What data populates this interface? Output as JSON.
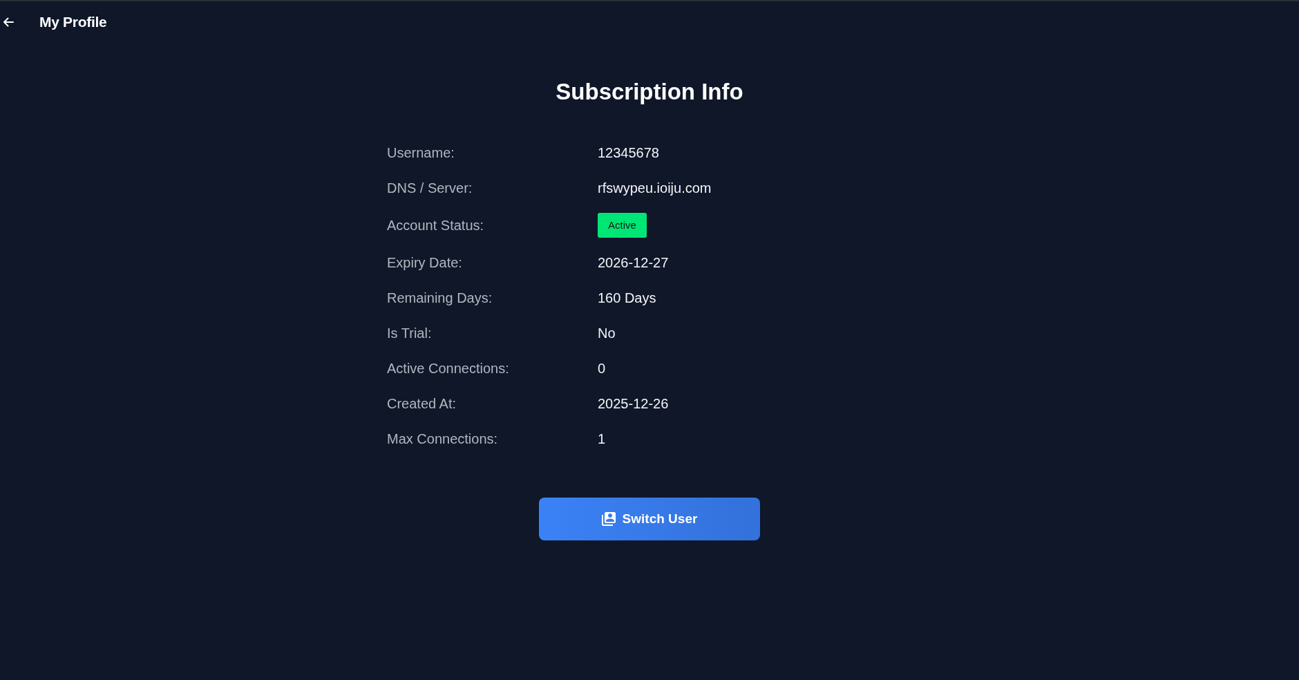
{
  "header": {
    "title": "My Profile"
  },
  "heading": "Subscription Info",
  "fields": [
    {
      "label": "Username:",
      "kind": "text",
      "value": "12345678"
    },
    {
      "label": "DNS / Server:",
      "kind": "text",
      "value": "rfswypeu.ioiju.com"
    },
    {
      "label": "Account Status:",
      "kind": "badge",
      "value": "Active"
    },
    {
      "label": "Expiry Date:",
      "kind": "text",
      "value": "2026-12-27"
    },
    {
      "label": "Remaining Days:",
      "kind": "text",
      "value": "160 Days"
    },
    {
      "label": "Is Trial:",
      "kind": "text",
      "value": "No"
    },
    {
      "label": "Active Connections:",
      "kind": "text",
      "value": "0"
    },
    {
      "label": "Created At:",
      "kind": "text",
      "value": "2025-12-26"
    },
    {
      "label": "Max Connections:",
      "kind": "text",
      "value": "1"
    }
  ],
  "button": {
    "label": "Switch User"
  }
}
